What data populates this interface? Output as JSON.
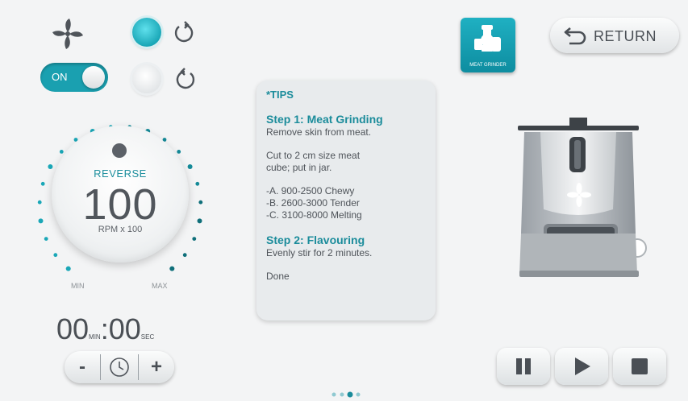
{
  "controls": {
    "power_toggle_label": "ON"
  },
  "dial": {
    "mode": "REVERSE",
    "value": "100",
    "unit": "RPM x 100",
    "min_label": "MIN",
    "max_label": "MAX"
  },
  "timer": {
    "minutes": "00",
    "min_label": "MIN",
    "separator": ":",
    "seconds": "00",
    "sec_label": "SEC",
    "minus_label": "-",
    "plus_label": "+"
  },
  "tips": {
    "header": "*TIPS",
    "step1_title": "Step 1: Meat Grinding",
    "step1_line1": "Remove skin from meat.",
    "step1_line2": "Cut to 2 cm size meat",
    "step1_line3": "cube; put in jar.",
    "option_a": "-A. 900-2500 Chewy",
    "option_b": "-B. 2600-3000 Tender",
    "option_c": "-C. 3100-8000 Melting",
    "step2_title": "Step 2: Flavouring",
    "step2_line1": "Evenly stir for 2 minutes.",
    "done": "Done"
  },
  "program": {
    "caption": "MEAT GRINDER"
  },
  "navigation": {
    "return_label": "RETURN"
  },
  "pager": {
    "total": 4,
    "active_index": 2
  },
  "colors": {
    "accent": "#1aa7b7",
    "accent_dark": "#1b8c9b"
  },
  "icons": [
    "fan-icon",
    "refresh-icon",
    "meat-grinder-icon",
    "return-arrow-icon",
    "clock-icon",
    "pause-icon",
    "play-icon",
    "stop-icon"
  ]
}
